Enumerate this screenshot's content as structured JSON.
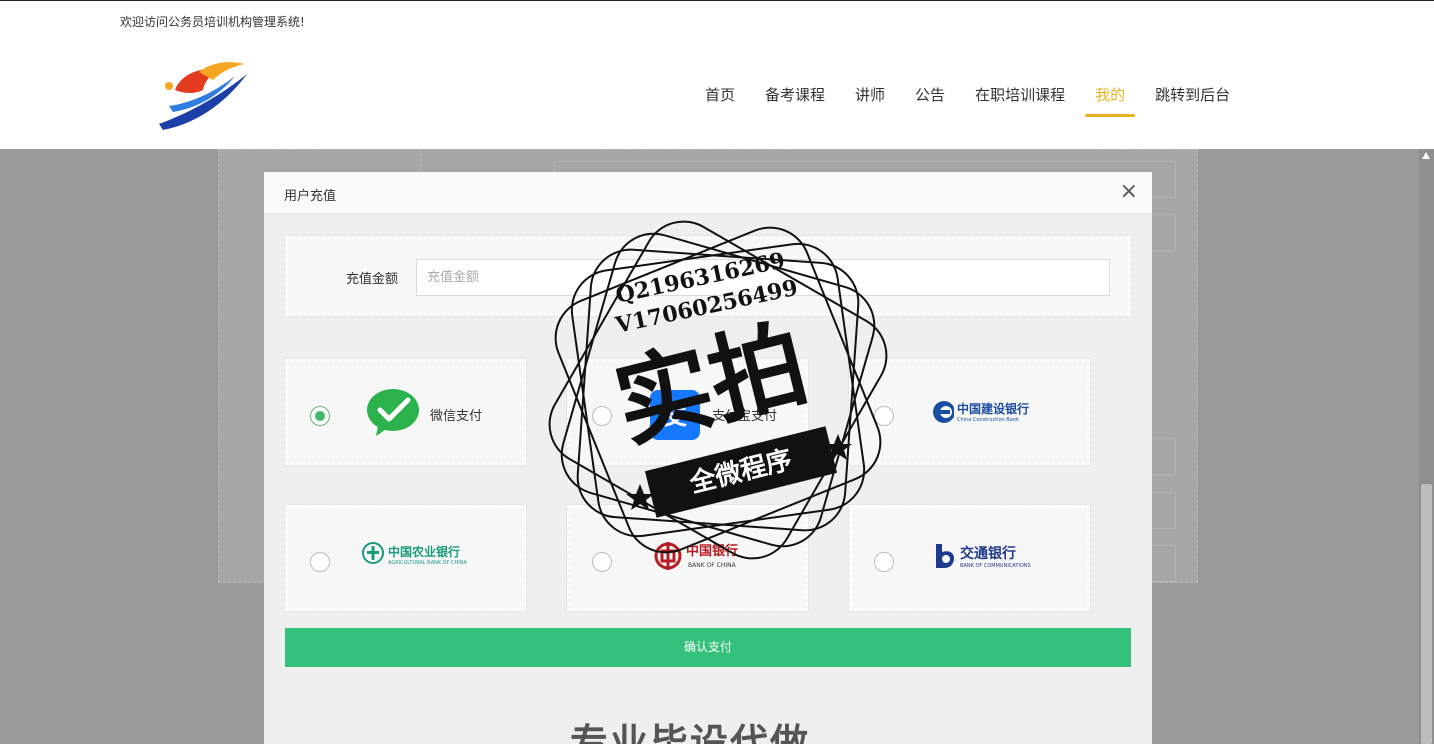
{
  "topbar": {
    "welcome": "欢迎访问公务员培训机构管理系统!"
  },
  "nav": {
    "items": [
      {
        "label": "首页",
        "active": false
      },
      {
        "label": "备考课程",
        "active": false
      },
      {
        "label": "讲师",
        "active": false
      },
      {
        "label": "公告",
        "active": false
      },
      {
        "label": "在职培训课程",
        "active": false
      },
      {
        "label": "我的",
        "active": true
      },
      {
        "label": "跳转到后台",
        "active": false
      }
    ],
    "active_color": "#e6b422"
  },
  "modal": {
    "title": "用户充值",
    "close_icon": "×",
    "amount_label": "充值金额",
    "amount_placeholder": "充值金额",
    "amount_value": "",
    "payment_options": [
      {
        "name": "微信支付",
        "icon": "wechat-pay-icon",
        "selected": true
      },
      {
        "name": "支付宝支付",
        "icon": "alipay-icon",
        "selected": false
      },
      {
        "name": "中国建设银行",
        "subtitle": "China Construction Bank",
        "icon": "ccb-icon",
        "selected": false
      },
      {
        "name": "中国农业银行",
        "subtitle": "AGRICULTURAL BANK OF CHINA",
        "icon": "abc-icon",
        "selected": false
      },
      {
        "name": "中国银行",
        "subtitle": "BANK OF CHINA",
        "icon": "boc-icon",
        "selected": false
      },
      {
        "name": "交通银行",
        "subtitle": "BANK OF COMMUNICATIONS",
        "icon": "bocom-icon",
        "selected": false
      }
    ],
    "confirm_label": "确认支付",
    "confirm_color": "#34c17b"
  },
  "watermark": {
    "line1": "Q2196316269",
    "line2": "V17060256499",
    "big": "实拍",
    "ribbon": "全微程序"
  },
  "slogan": "专业毕设代做"
}
